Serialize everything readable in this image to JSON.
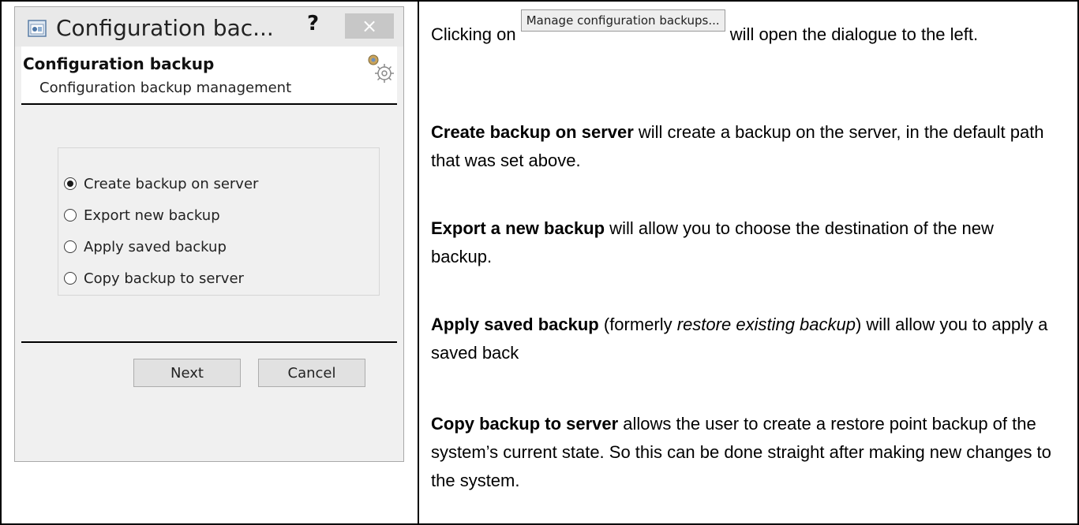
{
  "dialog": {
    "title": "Configuration bac...",
    "help_glyph": "?",
    "close_glyph": "×",
    "header_title": "Configuration backup",
    "header_subtitle": "Configuration backup management",
    "options": [
      {
        "label": "Create backup on server",
        "checked": true
      },
      {
        "label": "Export new backup",
        "checked": false
      },
      {
        "label": "Apply saved backup",
        "checked": false
      },
      {
        "label": "Copy backup to server",
        "checked": false
      }
    ],
    "next_label": "Next",
    "cancel_label": "Cancel",
    "colors": {
      "close_button": "#c7c7c7",
      "titlebar": "#e9e9e9",
      "body": "#f0f0f0"
    }
  },
  "text": {
    "p1_before": "Clicking on ",
    "p1_button": "Manage configuration backups...",
    "p1_after": " will open the dialogue to the left.",
    "p2_bold": "Create backup on server",
    "p2_rest": " will create a backup on the server, in the default path that was set above.",
    "p3_bold": "Export a new backup",
    "p3_rest": " will allow you to choose the destination of the new backup.",
    "p4_bold": "Apply saved backup",
    "p4_mid": " (formerly ",
    "p4_italic": "restore existing backup",
    "p4_rest": ") will allow you to apply a saved back",
    "p5_bold": "Copy backup to server",
    "p5_rest": " allows the user to create a restore point backup of the system’s current state. So this can be done straight after making new changes to the system."
  }
}
